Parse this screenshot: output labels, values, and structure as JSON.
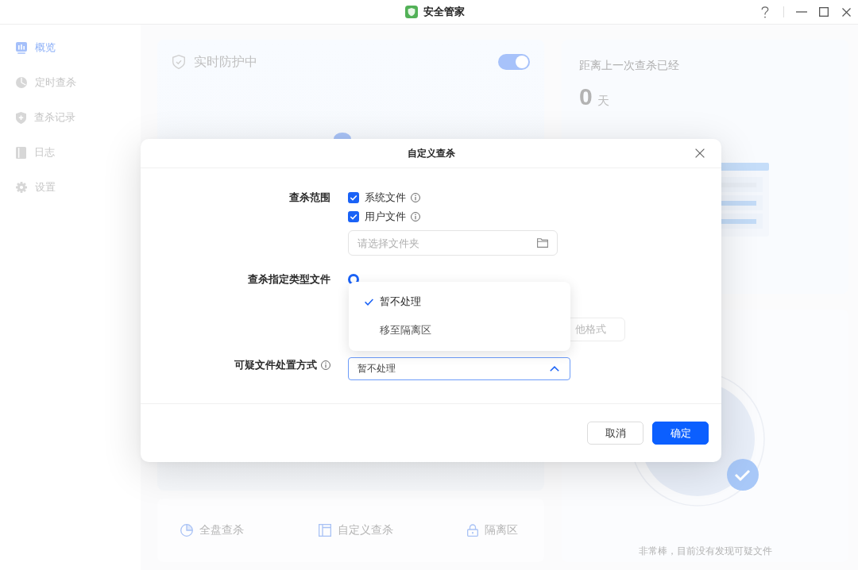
{
  "window": {
    "title": "安全管家"
  },
  "sidebar": {
    "items": [
      {
        "label": "概览",
        "kind": "chart",
        "selected": true
      },
      {
        "label": "定时查杀",
        "kind": "clock",
        "selected": false
      },
      {
        "label": "查杀记录",
        "kind": "shield",
        "selected": false
      },
      {
        "label": "日志",
        "kind": "book",
        "selected": false
      },
      {
        "label": "设置",
        "kind": "gear",
        "selected": false
      }
    ]
  },
  "protection_card": {
    "title": "实时防护中",
    "on": true
  },
  "quick_actions": [
    {
      "label": "全盘查杀",
      "kind": "pie"
    },
    {
      "label": "自定义查杀",
      "kind": "panel"
    },
    {
      "label": "隔离区",
      "kind": "lock"
    }
  ],
  "last_scan_card": {
    "caption": "距离上一次查杀已经",
    "value": "0",
    "unit": "天"
  },
  "status_card": {
    "message": "非常棒，目前没有发现可疑文件"
  },
  "dialog": {
    "title": "自定义查杀",
    "scope": {
      "label": "查杀范围",
      "options": [
        {
          "label": "系统文件",
          "checked": true
        },
        {
          "label": "用户文件",
          "checked": true
        }
      ],
      "folder_field": {
        "placeholder": "请选择文件夹"
      }
    },
    "file_types": {
      "label": "查杀指定类型文件",
      "radio": {
        "selected": true
      },
      "format_button": "他格式"
    },
    "handling": {
      "label": "可疑文件处置方式",
      "value": "暂不处理",
      "expanded": true,
      "options": [
        {
          "label": "暂不处理",
          "selected": true
        },
        {
          "label": "移至隔离区",
          "selected": false
        }
      ]
    },
    "buttons": [
      {
        "label": "取消",
        "kind": "secondary"
      },
      {
        "label": "确定",
        "kind": "primary"
      }
    ]
  }
}
